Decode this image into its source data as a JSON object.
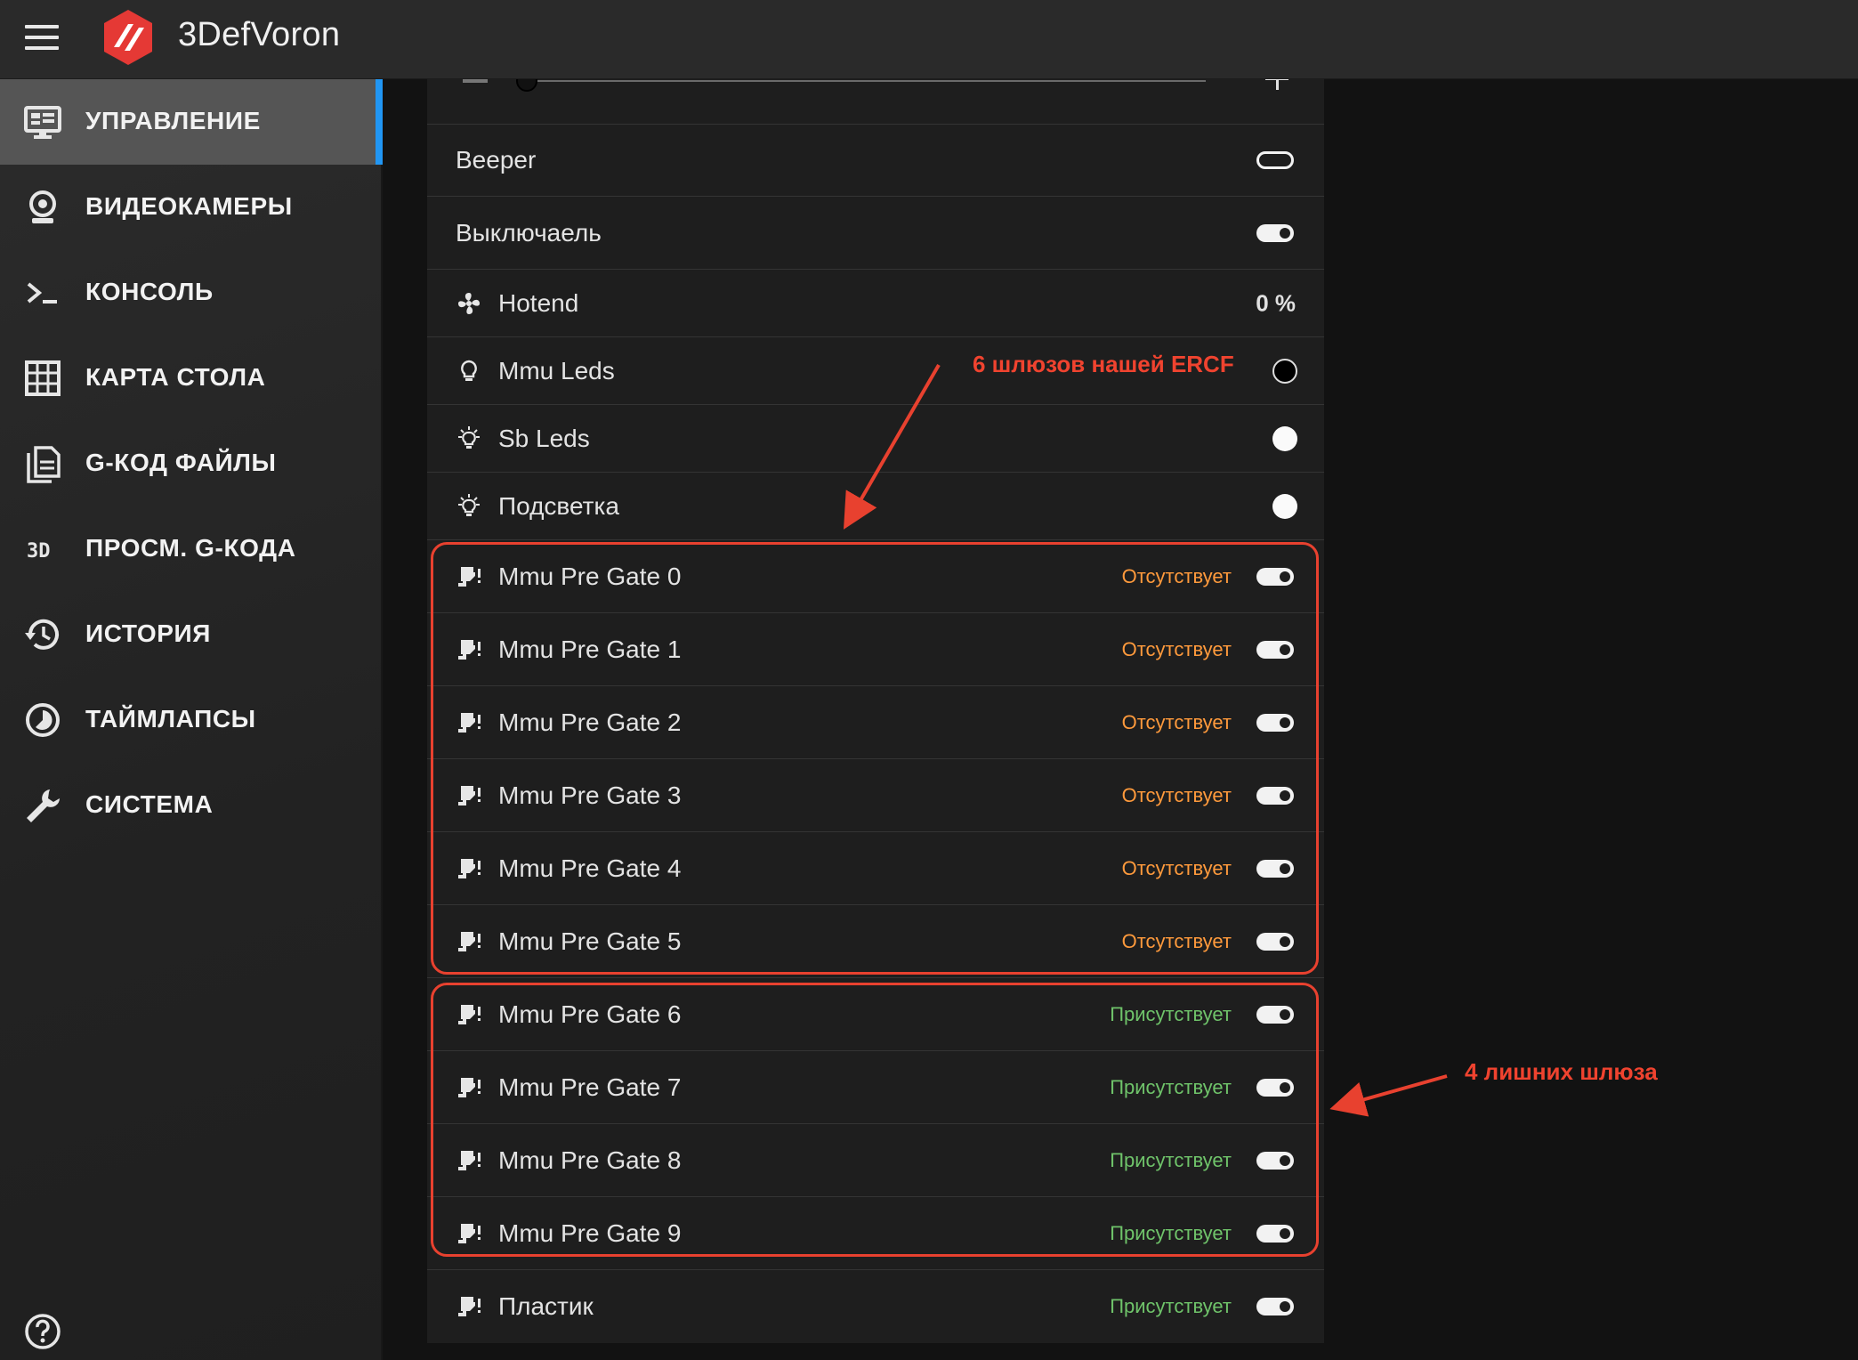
{
  "app": {
    "title": "3DefVoron"
  },
  "sidebar": {
    "items": [
      {
        "label": "УПРАВЛЕНИЕ",
        "icon": "monitor-dashboard-icon",
        "active": true
      },
      {
        "label": "ВИДЕОКАМЕРЫ",
        "icon": "webcam-icon"
      },
      {
        "label": "КОНСОЛЬ",
        "icon": "console-icon"
      },
      {
        "label": "КАРТА СТОЛА",
        "icon": "grid-icon"
      },
      {
        "label": "G-КОД ФАЙЛЫ",
        "icon": "files-icon"
      },
      {
        "label": "ПРОСМ. G-КОДА",
        "icon": "3d-icon"
      },
      {
        "label": "ИСТОРИЯ",
        "icon": "history-icon"
      },
      {
        "label": "ТАЙМЛАПСЫ",
        "icon": "timelapse-icon"
      },
      {
        "label": "СИСТЕМА",
        "icon": "wrench-icon"
      }
    ],
    "help_icon": "help-icon"
  },
  "rows": {
    "beeper": {
      "label": "Beeper",
      "state": "off"
    },
    "switch": {
      "label": "Выключаель",
      "state": "on"
    },
    "hotend": {
      "label": "Hotend",
      "value": "0 %",
      "icon": "fan-icon"
    },
    "mmu_leds": {
      "label": "Mmu Leds",
      "color": "black",
      "icon": "lightbulb-icon"
    },
    "sb_leds": {
      "label": "Sb Leds",
      "color": "white",
      "icon": "lightbulb-on-icon"
    },
    "backlight": {
      "label": "Подсветка",
      "color": "white",
      "icon": "lightbulb-on-icon"
    }
  },
  "gates": [
    {
      "label": "Mmu Pre Gate 0",
      "status": "Отсутствует",
      "kind": "absent"
    },
    {
      "label": "Mmu Pre Gate 1",
      "status": "Отсутствует",
      "kind": "absent"
    },
    {
      "label": "Mmu Pre Gate 2",
      "status": "Отсутствует",
      "kind": "absent"
    },
    {
      "label": "Mmu Pre Gate 3",
      "status": "Отсутствует",
      "kind": "absent"
    },
    {
      "label": "Mmu Pre Gate 4",
      "status": "Отсутствует",
      "kind": "absent"
    },
    {
      "label": "Mmu Pre Gate 5",
      "status": "Отсутствует",
      "kind": "absent"
    },
    {
      "label": "Mmu Pre Gate 6",
      "status": "Присутствует",
      "kind": "present"
    },
    {
      "label": "Mmu Pre Gate 7",
      "status": "Присутствует",
      "kind": "present"
    },
    {
      "label": "Mmu Pre Gate 8",
      "status": "Присутствует",
      "kind": "present"
    },
    {
      "label": "Mmu Pre Gate 9",
      "status": "Присутствует",
      "kind": "present"
    },
    {
      "label": "Пластик",
      "status": "Присутствует",
      "kind": "present"
    }
  ],
  "annotations": {
    "top": "6 шлюзов нашей ERCF",
    "right": "4 лишних шлюза",
    "color": "#e8412f"
  },
  "colors": {
    "accent": "#2196f3",
    "absent": "#ff9a3c",
    "present": "#6fc36a",
    "logo": "#e53935"
  }
}
